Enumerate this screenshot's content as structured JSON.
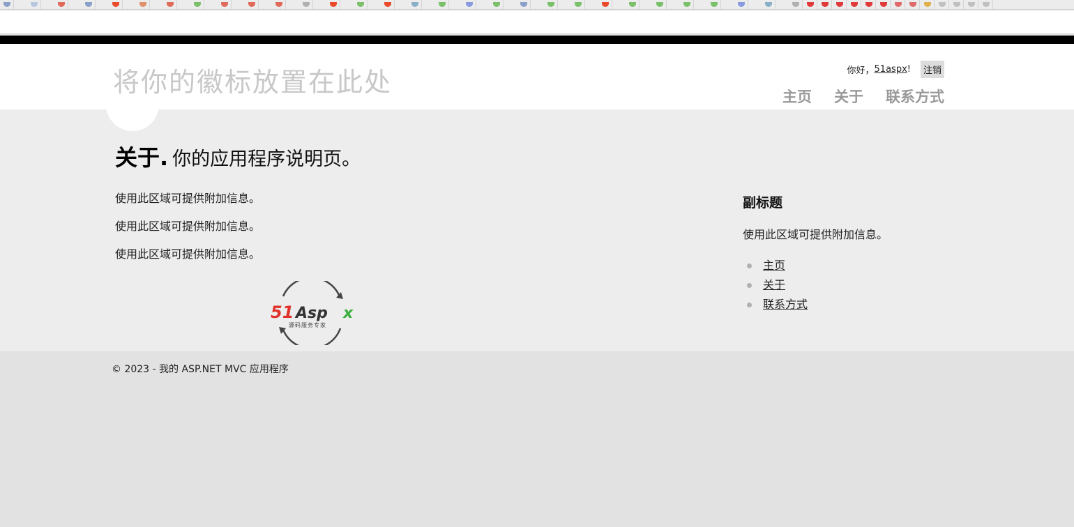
{
  "header": {
    "site_title": "将你的徽标放置在此处",
    "greeting": "你好，",
    "username": "51aspx",
    "greeting_suffix": "!",
    "logout_label": "注销",
    "nav": [
      {
        "label": "主页"
      },
      {
        "label": "关于"
      },
      {
        "label": "联系方式"
      }
    ]
  },
  "main": {
    "title": "关于.",
    "subtitle": "你的应用程序说明页。",
    "paragraphs": [
      "使用此区域可提供附加信息。",
      "使用此区域可提供附加信息。",
      "使用此区域可提供附加信息。"
    ],
    "logo": {
      "wordmark_left": "51",
      "wordmark_mid": "Asp",
      "wordmark_right": "x",
      "tagline": "源码服务专家",
      "colors": {
        "red": "#e0322a",
        "dark": "#333333",
        "green": "#3cae3c"
      }
    }
  },
  "aside": {
    "heading": "副标题",
    "text": "使用此区域可提供附加信息。",
    "links": [
      {
        "label": "主页"
      },
      {
        "label": "关于"
      },
      {
        "label": "联系方式"
      }
    ]
  },
  "footer": {
    "copyright": "© 2023 - 我的 ASP.NET MVC 应用程序"
  },
  "colors": {
    "header_bg": "#ffffff",
    "main_bg": "#ededed",
    "footer_bg": "#e2e2e2",
    "nav_text": "#999999",
    "site_title": "#c8c8c8"
  }
}
